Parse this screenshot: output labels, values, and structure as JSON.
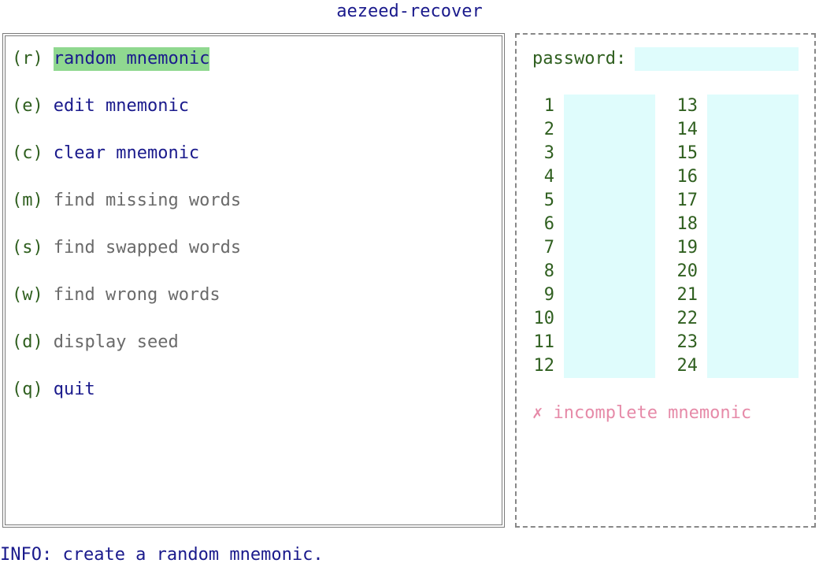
{
  "app": {
    "title": "aezeed-recover"
  },
  "menu": [
    {
      "key": "(r)",
      "label": "random mnemonic",
      "state": "selected"
    },
    {
      "key": "(e)",
      "label": "edit mnemonic",
      "state": "enabled"
    },
    {
      "key": "(c)",
      "label": "clear mnemonic",
      "state": "enabled"
    },
    {
      "key": "(m)",
      "label": "find missing words",
      "state": "disabled"
    },
    {
      "key": "(s)",
      "label": "find swapped words",
      "state": "disabled"
    },
    {
      "key": "(w)",
      "label": "find wrong words",
      "state": "disabled"
    },
    {
      "key": "(d)",
      "label": "display seed",
      "state": "disabled"
    },
    {
      "key": "(q)",
      "label": "quit",
      "state": "enabled"
    }
  ],
  "password": {
    "label": "password:",
    "value": ""
  },
  "words": [
    {
      "num": "1",
      "value": ""
    },
    {
      "num": "2",
      "value": ""
    },
    {
      "num": "3",
      "value": ""
    },
    {
      "num": "4",
      "value": ""
    },
    {
      "num": "5",
      "value": ""
    },
    {
      "num": "6",
      "value": ""
    },
    {
      "num": "7",
      "value": ""
    },
    {
      "num": "8",
      "value": ""
    },
    {
      "num": "9",
      "value": ""
    },
    {
      "num": "10",
      "value": ""
    },
    {
      "num": "11",
      "value": ""
    },
    {
      "num": "12",
      "value": ""
    },
    {
      "num": "13",
      "value": ""
    },
    {
      "num": "14",
      "value": ""
    },
    {
      "num": "15",
      "value": ""
    },
    {
      "num": "16",
      "value": ""
    },
    {
      "num": "17",
      "value": ""
    },
    {
      "num": "18",
      "value": ""
    },
    {
      "num": "19",
      "value": ""
    },
    {
      "num": "20",
      "value": ""
    },
    {
      "num": "21",
      "value": ""
    },
    {
      "num": "22",
      "value": ""
    },
    {
      "num": "23",
      "value": ""
    },
    {
      "num": "24",
      "value": ""
    }
  ],
  "status": {
    "icon": "cross-icon",
    "text": "✗ incomplete mnemonic",
    "color": "#e68aa8"
  },
  "info": {
    "text": "INFO: create a random mnemonic."
  },
  "colors": {
    "accent": "#1a1a8c",
    "key": "#2f5f1f",
    "selected_bg": "#90d890",
    "field_bg": "#dffcfc",
    "disabled": "#6a6a6a"
  }
}
